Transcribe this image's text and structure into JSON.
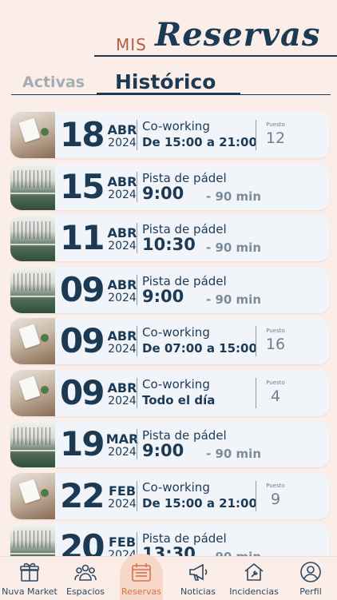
{
  "header": {
    "title_small": "MIS",
    "title_big": "Reservas"
  },
  "tabs": {
    "activas": "Activas",
    "historico": "Histórico"
  },
  "reservations": [
    {
      "day": "18",
      "month": "ABR",
      "year": "2024",
      "type": "Co-working",
      "time": "De 15:00 a 21:00",
      "duration": "",
      "puesto_label": "Puesto",
      "puesto": "12",
      "image": "coworking"
    },
    {
      "day": "15",
      "month": "ABR",
      "year": "2024",
      "type": "Pista de pádel",
      "time": "9:00",
      "duration": "- 90 min",
      "puesto_label": "",
      "puesto": "",
      "image": "padel"
    },
    {
      "day": "11",
      "month": "ABR",
      "year": "2024",
      "type": "Pista de pádel",
      "time": "10:30",
      "duration": "- 90 min",
      "puesto_label": "",
      "puesto": "",
      "image": "padel"
    },
    {
      "day": "09",
      "month": "ABR",
      "year": "2024",
      "type": "Pista de pádel",
      "time": "9:00",
      "duration": "- 90 min",
      "puesto_label": "",
      "puesto": "",
      "image": "padel"
    },
    {
      "day": "09",
      "month": "ABR",
      "year": "2024",
      "type": "Co-working",
      "time": "De 07:00 a 15:00",
      "duration": "",
      "puesto_label": "Puesto",
      "puesto": "16",
      "image": "coworking"
    },
    {
      "day": "09",
      "month": "ABR",
      "year": "2024",
      "type": "Co-working",
      "time": "Todo el día",
      "duration": "",
      "puesto_label": "Puesto",
      "puesto": "4",
      "image": "coworking"
    },
    {
      "day": "19",
      "month": "MAR",
      "year": "2024",
      "type": "Pista de pádel",
      "time": "9:00",
      "duration": "- 90 min",
      "puesto_label": "",
      "puesto": "",
      "image": "padel"
    },
    {
      "day": "22",
      "month": "FEB",
      "year": "2024",
      "type": "Co-working",
      "time": "De 15:00 a 21:00",
      "duration": "",
      "puesto_label": "Puesto",
      "puesto": "9",
      "image": "coworking"
    },
    {
      "day": "20",
      "month": "FEB",
      "year": "2024",
      "type": "Pista de pádel",
      "time": "13:30",
      "duration": "- 90 min",
      "puesto_label": "",
      "puesto": "",
      "image": "padel"
    }
  ],
  "nav": {
    "items": [
      {
        "label": "Nuva Market",
        "icon": "gift-icon",
        "active": false
      },
      {
        "label": "Espacios",
        "icon": "people-icon",
        "active": false
      },
      {
        "label": "Reservas",
        "icon": "calendar-icon",
        "active": true
      },
      {
        "label": "Noticias",
        "icon": "megaphone-icon",
        "active": false
      },
      {
        "label": "Incidencias",
        "icon": "house-wrench-icon",
        "active": false
      },
      {
        "label": "Perfil",
        "icon": "user-icon",
        "active": false
      }
    ]
  },
  "colors": {
    "primary": "#1d3a55",
    "accent": "#d3754b",
    "background": "#fbeee9",
    "card": "#f1f5fa"
  }
}
